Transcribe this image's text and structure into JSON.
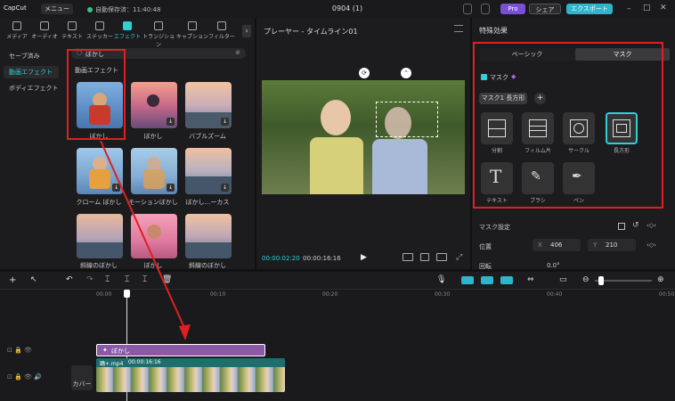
{
  "titlebar": {
    "logo": "CapCut",
    "menu": "メニュー",
    "autosave": "自動保存済：11:40:48",
    "title": "0904 (1)",
    "pro": "Pro",
    "share": "シェア",
    "export": "エクスポート"
  },
  "tabs": [
    {
      "label": "メディア"
    },
    {
      "label": "オーディオ"
    },
    {
      "label": "テキスト"
    },
    {
      "label": "ステッカー"
    },
    {
      "label": "エフェクト"
    },
    {
      "label": "トランジション"
    },
    {
      "label": "キャプション"
    },
    {
      "label": "フィルター"
    }
  ],
  "left_side": {
    "saved": "セーブ済み",
    "video_effects": "動画エフェクト",
    "body_effects": "ボディエフェクト"
  },
  "search": {
    "value": "ぼかし"
  },
  "effects_heading": "動画エフェクト",
  "effects": [
    {
      "label": "ぼかし"
    },
    {
      "label": "ぼかし"
    },
    {
      "label": "バブルズーム"
    },
    {
      "label": "クローム ぼかし"
    },
    {
      "label": "モーションぼかし"
    },
    {
      "label": "ぼかし...ーカス"
    },
    {
      "label": "斜線のぼかし"
    },
    {
      "label": "ぼかし"
    },
    {
      "label": "斜線のぼかし"
    }
  ],
  "player": {
    "title": "プレーヤー - タイムライン01",
    "time_current": "00:00:02:20",
    "time_total": "00:00:16:16"
  },
  "right": {
    "header": "特殊効果",
    "tab_basic": "ベーシック",
    "tab_mask": "マスク",
    "mask_label": "マスク",
    "mask_chip": "マスク1 長方形",
    "mask_items": [
      {
        "label": "分割"
      },
      {
        "label": "フィルム片"
      },
      {
        "label": "サークル"
      },
      {
        "label": "長方形"
      },
      {
        "label": "テキスト"
      },
      {
        "label": "ブラシ"
      },
      {
        "label": "ペン"
      }
    ],
    "mask_settings": "マスク設定",
    "position_label": "位置",
    "x_label": "X",
    "x_value": "406",
    "y_label": "Y",
    "y_value": "210",
    "rotate_label": "回転",
    "rotate_value": "0.0°"
  },
  "timeline": {
    "ticks": [
      "00:00",
      "00:10",
      "00:20",
      "00:30",
      "00:40",
      "00:50"
    ],
    "effect_clip": "ぼかし",
    "video_clip": "踊+.mp4",
    "video_duration": "00:00:16:16",
    "cover": "カバー"
  }
}
